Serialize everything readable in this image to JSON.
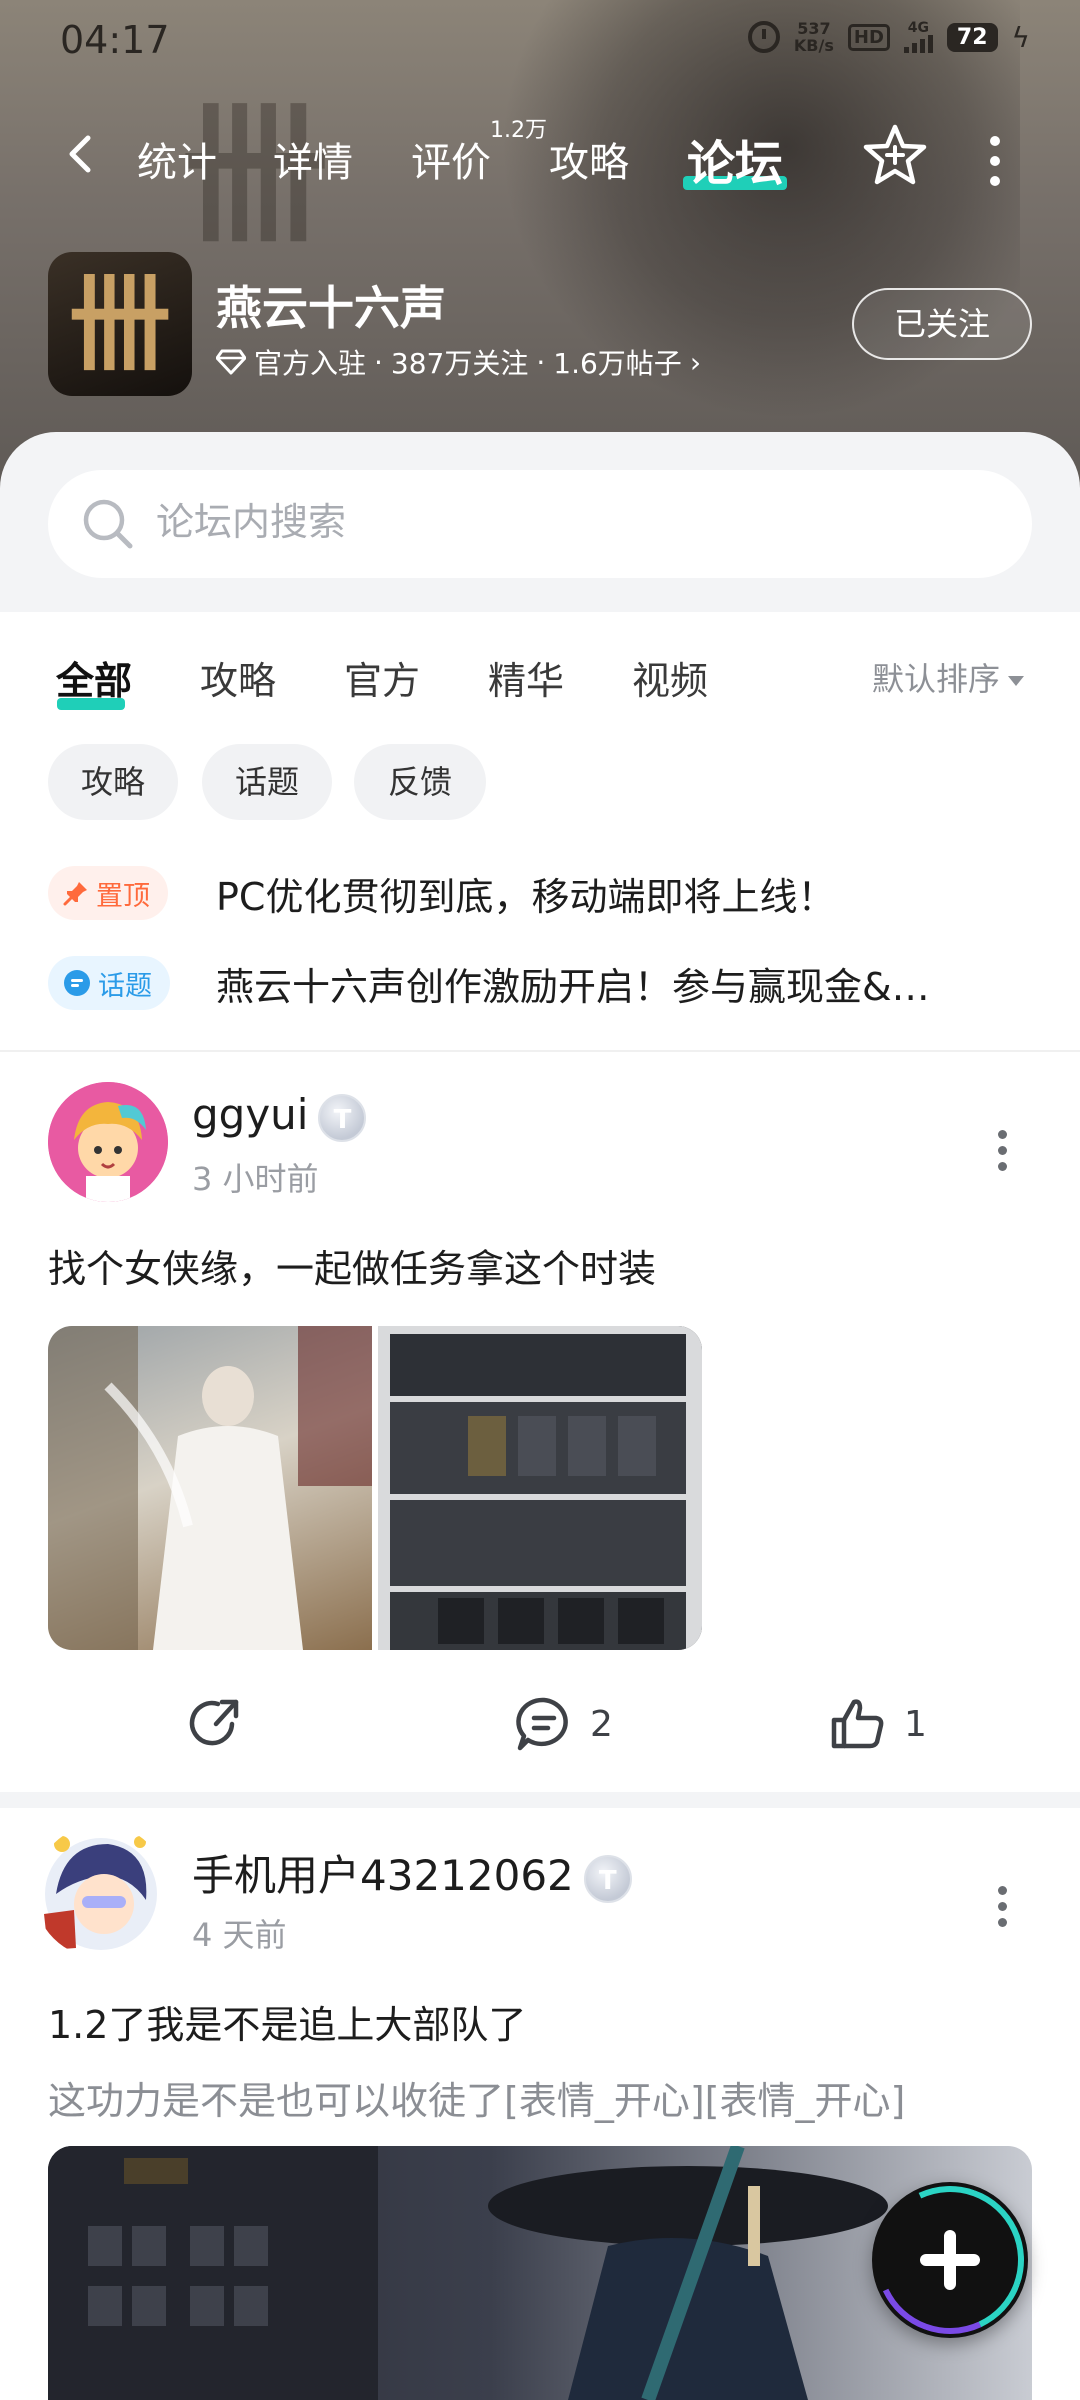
{
  "status_bar": {
    "time": "04:17",
    "net_speed_value": "537",
    "net_speed_unit": "KB/s",
    "hd_label": "HD",
    "network": "4G",
    "battery": "72"
  },
  "nav": {
    "tabs": [
      {
        "label": "统计"
      },
      {
        "label": "详情"
      },
      {
        "label": "评价",
        "badge": "1.2万"
      },
      {
        "label": "攻略"
      },
      {
        "label": "论坛",
        "active": true
      }
    ],
    "accent_color": "#1fcfb8"
  },
  "game": {
    "title": "燕云十六声",
    "verified_label": "官方入驻",
    "followers": "387万关注",
    "posts": "1.6万帖子",
    "follow_button_label": "已关注"
  },
  "search": {
    "placeholder": "论坛内搜索"
  },
  "category_tabs": [
    {
      "label": "全部",
      "active": true
    },
    {
      "label": "攻略"
    },
    {
      "label": "官方"
    },
    {
      "label": "精华"
    },
    {
      "label": "视频"
    }
  ],
  "sort": {
    "selected": "默认排序"
  },
  "chips": [
    {
      "label": "攻略"
    },
    {
      "label": "话题"
    },
    {
      "label": "反馈"
    }
  ],
  "pinned": [
    {
      "badge": "置顶",
      "text": "PC优化贯彻到底，移动端即将上线！",
      "badge_color": "#ff6a3c"
    },
    {
      "badge": "话题",
      "text": "燕云十六声创作激励开启！参与赢现金&…",
      "badge_color": "#2b9be8"
    }
  ],
  "posts": [
    {
      "author": "ggyui",
      "level": "T",
      "time": "3 小时前",
      "title": "找个女侠缘，一起做任务拿这个时装",
      "comments": "2",
      "likes": "1"
    },
    {
      "author": "手机用户43212062",
      "level": "T",
      "time": "4 天前",
      "title": "1.2了我是不是追上大部队了",
      "body": "这功力是不是也可以收徒了[表情_开心][表情_开心]"
    }
  ]
}
